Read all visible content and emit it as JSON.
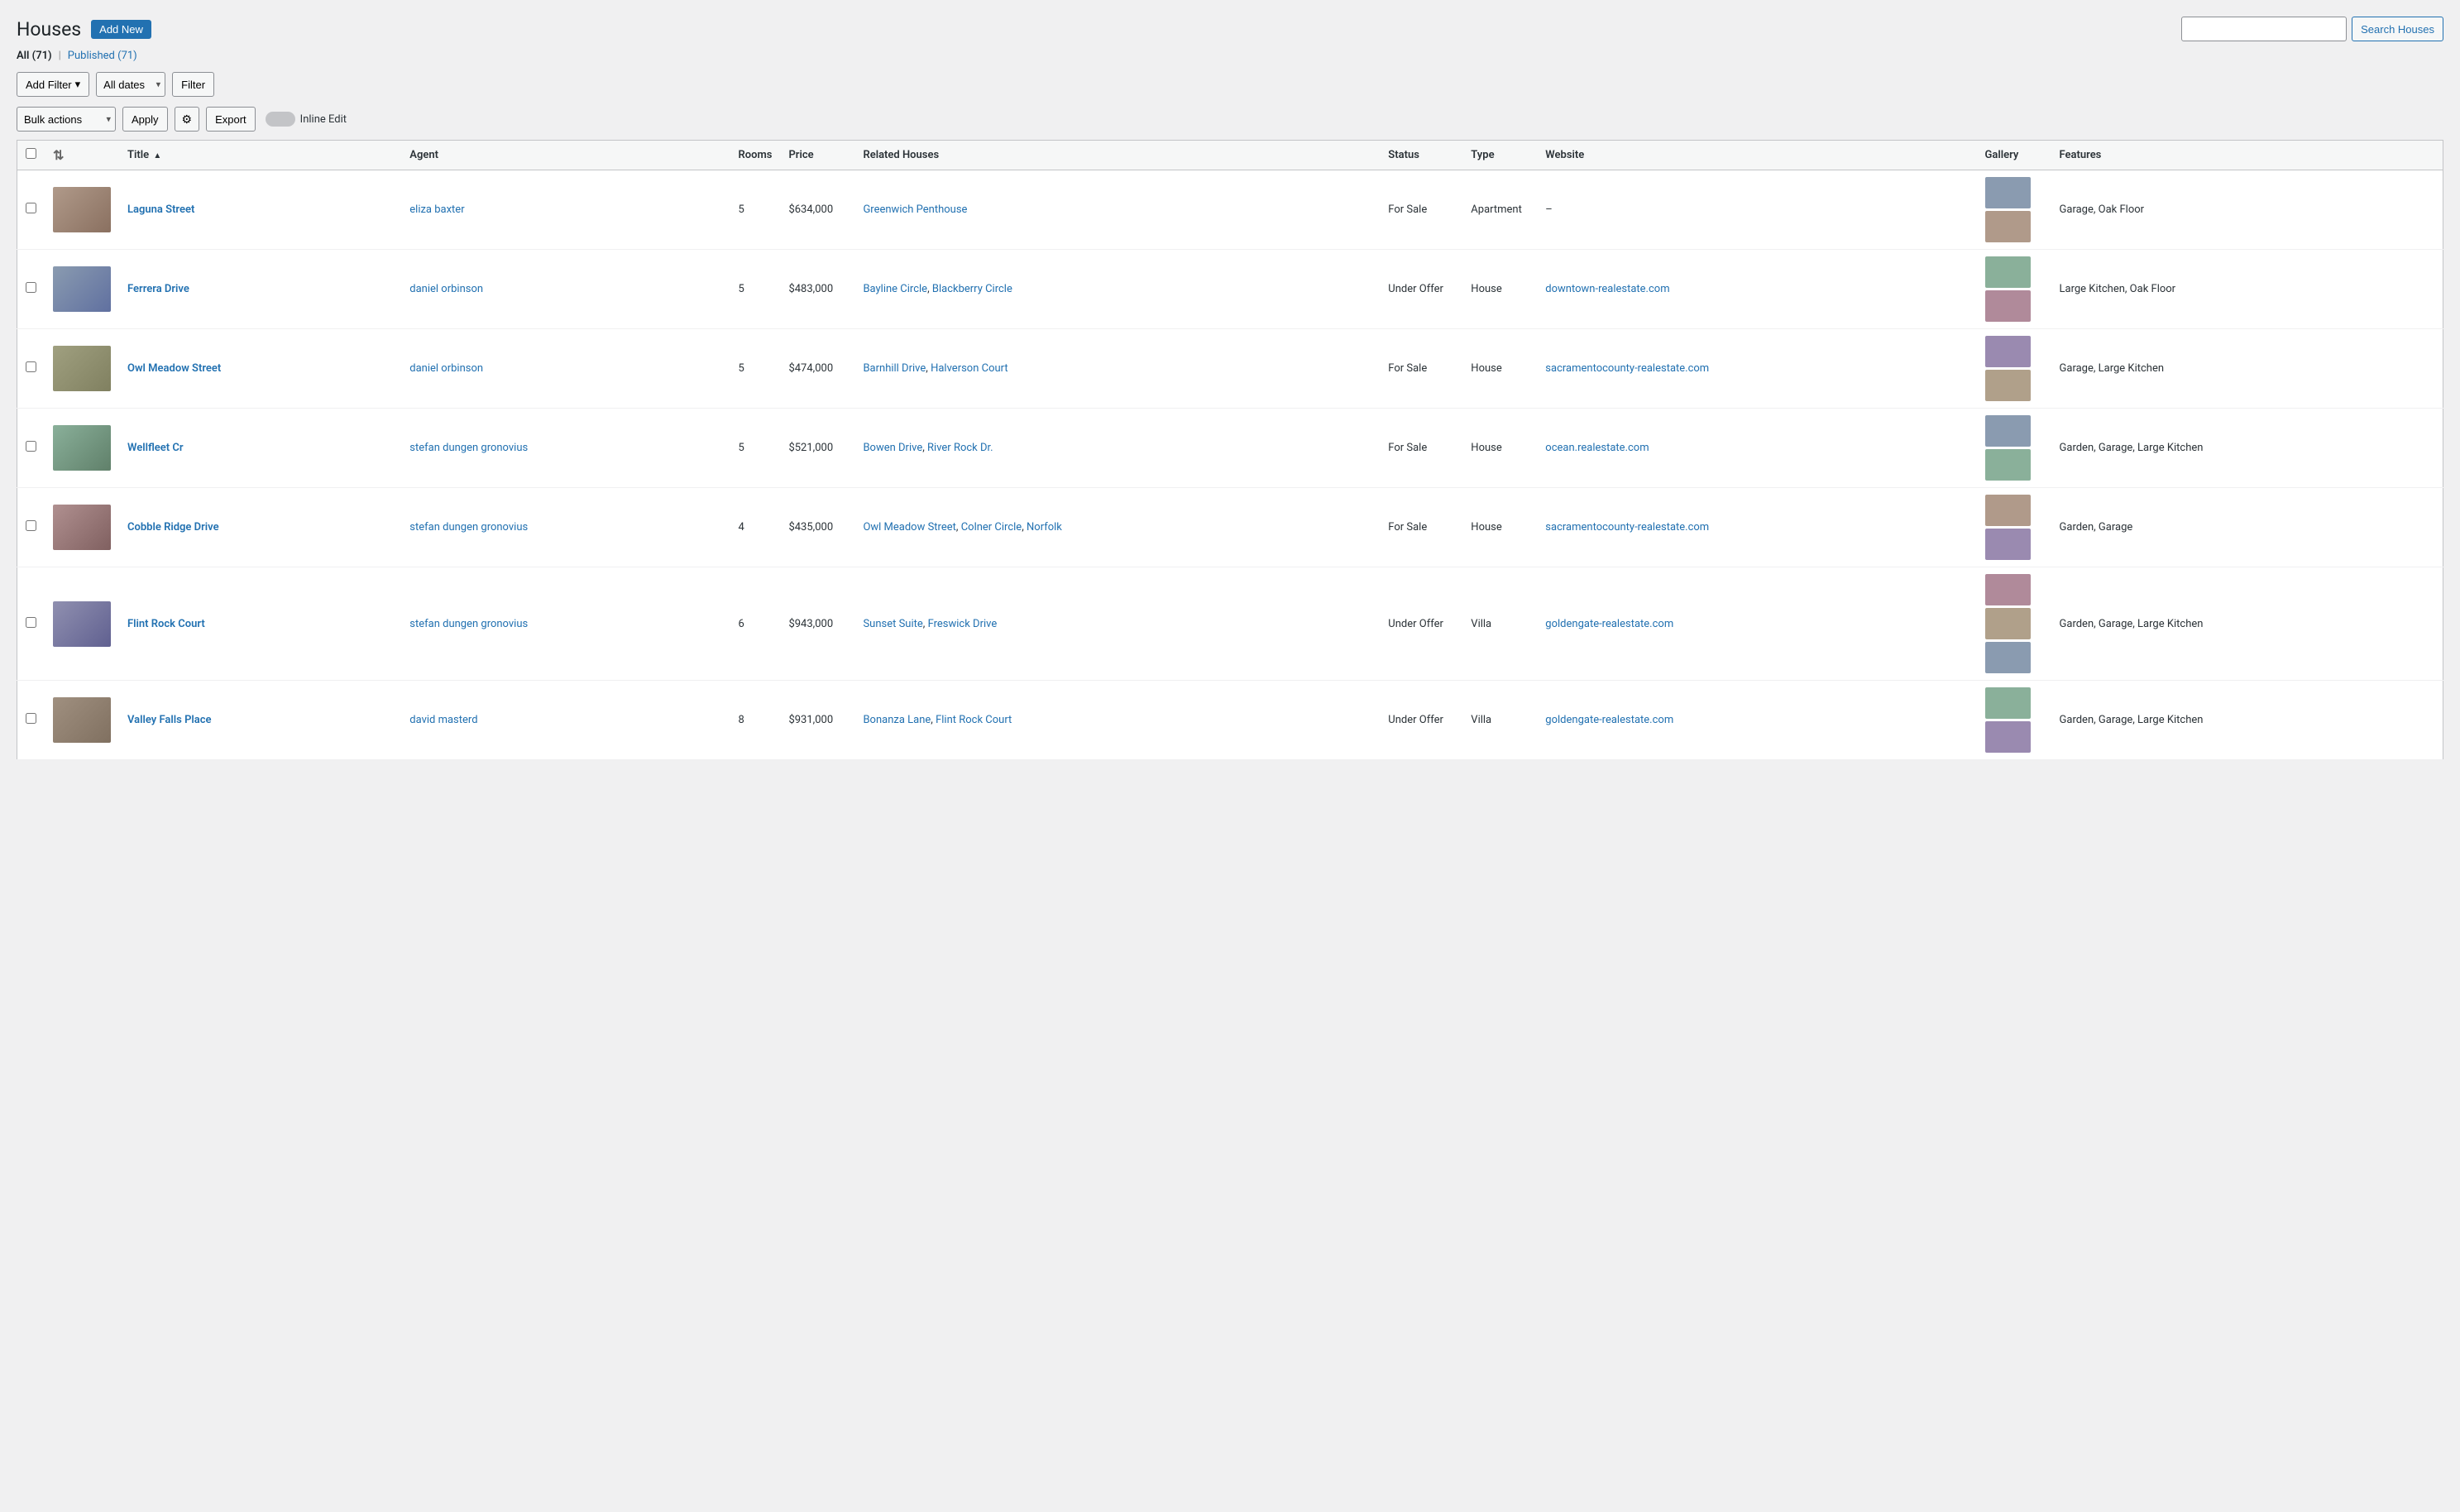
{
  "page": {
    "title": "Houses",
    "add_new_label": "Add New"
  },
  "search": {
    "placeholder": "",
    "button_label": "Search Houses"
  },
  "status_bar": {
    "all_label": "All",
    "all_count": "(71)",
    "separator": "|",
    "published_label": "Published",
    "published_count": "(71)"
  },
  "filters": {
    "add_filter_label": "Add Filter",
    "date_options": [
      "All dates"
    ],
    "filter_label": "Filter"
  },
  "actions": {
    "bulk_label": "Bulk actions",
    "apply_label": "Apply",
    "export_label": "Export",
    "inline_edit_label": "Inline Edit"
  },
  "table": {
    "columns": [
      "",
      "",
      "Title",
      "Agent",
      "Rooms",
      "Price",
      "Related Houses",
      "Status",
      "Type",
      "Website",
      "Gallery",
      "Features"
    ],
    "rows": [
      {
        "id": 1,
        "img_class": "hi1",
        "title": "Laguna Street",
        "agent": "eliza baxter",
        "rooms": "5",
        "price": "$634,000",
        "related": [
          "Greenwich Penthouse"
        ],
        "related_sep": [],
        "status": "For Sale",
        "type": "Apartment",
        "website": "–",
        "website_link": false,
        "gallery_colors": [
          "g1",
          "g2"
        ],
        "features": "Garage, Oak Floor"
      },
      {
        "id": 2,
        "img_class": "hi2",
        "title": "Ferrera Drive",
        "agent": "daniel orbinson",
        "rooms": "5",
        "price": "$483,000",
        "related": [
          "Bayline Circle",
          "Blackberry Circle"
        ],
        "related_sep": [
          ","
        ],
        "status": "Under Offer",
        "type": "House",
        "website": "downtown-realestate.com",
        "website_link": true,
        "gallery_colors": [
          "g3",
          "g4"
        ],
        "features": "Large Kitchen, Oak Floor"
      },
      {
        "id": 3,
        "img_class": "hi3",
        "title": "Owl Meadow Street",
        "agent": "daniel orbinson",
        "rooms": "5",
        "price": "$474,000",
        "related": [
          "Barnhill Drive",
          "Halverson Court"
        ],
        "related_sep": [
          ","
        ],
        "status": "For Sale",
        "type": "House",
        "website": "sacramentocounty-realestate.com",
        "website_link": true,
        "gallery_colors": [
          "g5",
          "g6"
        ],
        "features": "Garage, Large Kitchen"
      },
      {
        "id": 4,
        "img_class": "hi4",
        "title": "Wellfleet Cr",
        "agent": "stefan dungen gronovius",
        "rooms": "5",
        "price": "$521,000",
        "related": [
          "Bowen Drive",
          "River Rock Dr."
        ],
        "related_sep": [
          ","
        ],
        "status": "For Sale",
        "type": "House",
        "website": "ocean.realestate.com",
        "website_link": true,
        "gallery_colors": [
          "g1",
          "g3"
        ],
        "features": "Garden, Garage, Large Kitchen"
      },
      {
        "id": 5,
        "img_class": "hi5",
        "title": "Cobble Ridge Drive",
        "agent": "stefan dungen gronovius",
        "rooms": "4",
        "price": "$435,000",
        "related": [
          "Owl Meadow Street",
          "Colner Circle",
          "Norfolk"
        ],
        "related_sep": [
          ",",
          ","
        ],
        "status": "For Sale",
        "type": "House",
        "website": "sacramentocounty-realestate.com",
        "website_link": true,
        "gallery_colors": [
          "g2",
          "g5"
        ],
        "features": "Garden, Garage"
      },
      {
        "id": 6,
        "img_class": "hi6",
        "title": "Flint Rock Court",
        "agent": "stefan dungen gronovius",
        "rooms": "6",
        "price": "$943,000",
        "related": [
          "Sunset Suite",
          "Freswick Drive"
        ],
        "related_sep": [
          ","
        ],
        "status": "Under Offer",
        "type": "Villa",
        "website": "goldengate-realestate.com",
        "website_link": true,
        "gallery_colors": [
          "g4",
          "g6",
          "g1"
        ],
        "features": "Garden, Garage, Large Kitchen"
      },
      {
        "id": 7,
        "img_class": "hi7",
        "title": "Valley Falls Place",
        "agent": "david masterd",
        "rooms": "8",
        "price": "$931,000",
        "related": [
          "Bonanza Lane",
          "Flint Rock Court"
        ],
        "related_sep": [
          ","
        ],
        "status": "Under Offer",
        "type": "Villa",
        "website": "goldengate-realestate.com",
        "website_link": true,
        "gallery_colors": [
          "g3",
          "g5"
        ],
        "features": "Garden, Garage, Large Kitchen"
      }
    ]
  }
}
